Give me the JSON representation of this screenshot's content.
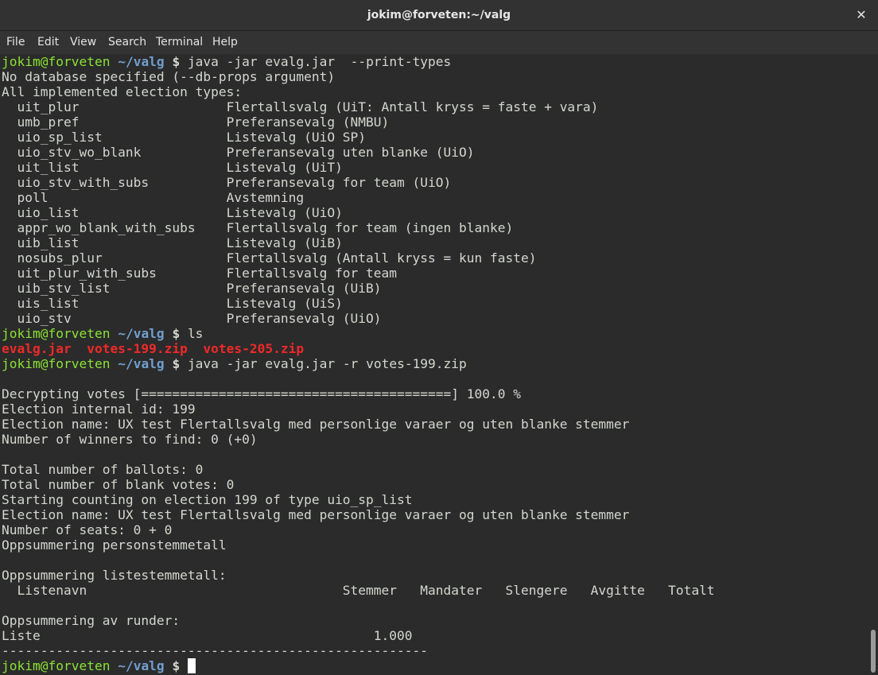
{
  "window": {
    "title": "jokim@forveten:~/valg",
    "close_symbol": "✕"
  },
  "menu": [
    "File",
    "Edit",
    "View",
    "Search",
    "Terminal",
    "Help"
  ],
  "prompt": {
    "userhost": "jokim@forveten",
    "path": "~/valg",
    "symbol": "$"
  },
  "terminal": {
    "commands": {
      "c1": "java -jar evalg.jar  --print-types",
      "c2": "ls",
      "c3": "java -jar evalg.jar -r votes-199.zip"
    },
    "ls_output": "evalg.jar  votes-199.zip  votes-205.zip",
    "output1": [
      "No database specified (--db-props argument)",
      "All implemented election types:",
      "  uit_plur                   Flertallsvalg (UiT: Antall kryss = faste + vara)",
      "  umb_pref                   Preferansevalg (NMBU)",
      "  uio_sp_list                Listevalg (UiO SP)",
      "  uio_stv_wo_blank           Preferansevalg uten blanke (UiO)",
      "  uit_list                   Listevalg (UiT)",
      "  uio_stv_with_subs          Preferansevalg for team (UiO)",
      "  poll                       Avstemning",
      "  uio_list                   Listevalg (UiO)",
      "  appr_wo_blank_with_subs    Flertallsvalg for team (ingen blanke)",
      "  uib_list                   Listevalg (UiB)",
      "  nosubs_plur                Flertallsvalg (Antall kryss = kun faste)",
      "  uit_plur_with_subs         Flertallsvalg for team",
      "  uib_stv_list               Preferansevalg (UiB)",
      "  uis_list                   Listevalg (UiS)",
      "  uio_stv                    Preferansevalg (UiO)"
    ],
    "output2": [
      "",
      "Decrypting votes [========================================] 100.0 %",
      "Election internal id: 199",
      "Election name: UX test Flertallsvalg med personlige varaer og uten blanke stemmer",
      "Number of winners to find: 0 (+0)",
      "",
      "Total number of ballots: 0",
      "Total number of blank votes: 0",
      "Starting counting on election 199 of type uio_sp_list",
      "Election name: UX test Flertallsvalg med personlige varaer og uten blanke stemmer",
      "Number of seats: 0 + 0",
      "Oppsummering personstemmetall",
      "",
      "Oppsummering listestemmetall:",
      "  Listenavn                                 Stemmer   Mandater   Slengere   Avgitte   Totalt",
      "",
      "Oppsummering av runder:",
      "Liste                                           1.000",
      "-------------------------------------------------------"
    ]
  }
}
